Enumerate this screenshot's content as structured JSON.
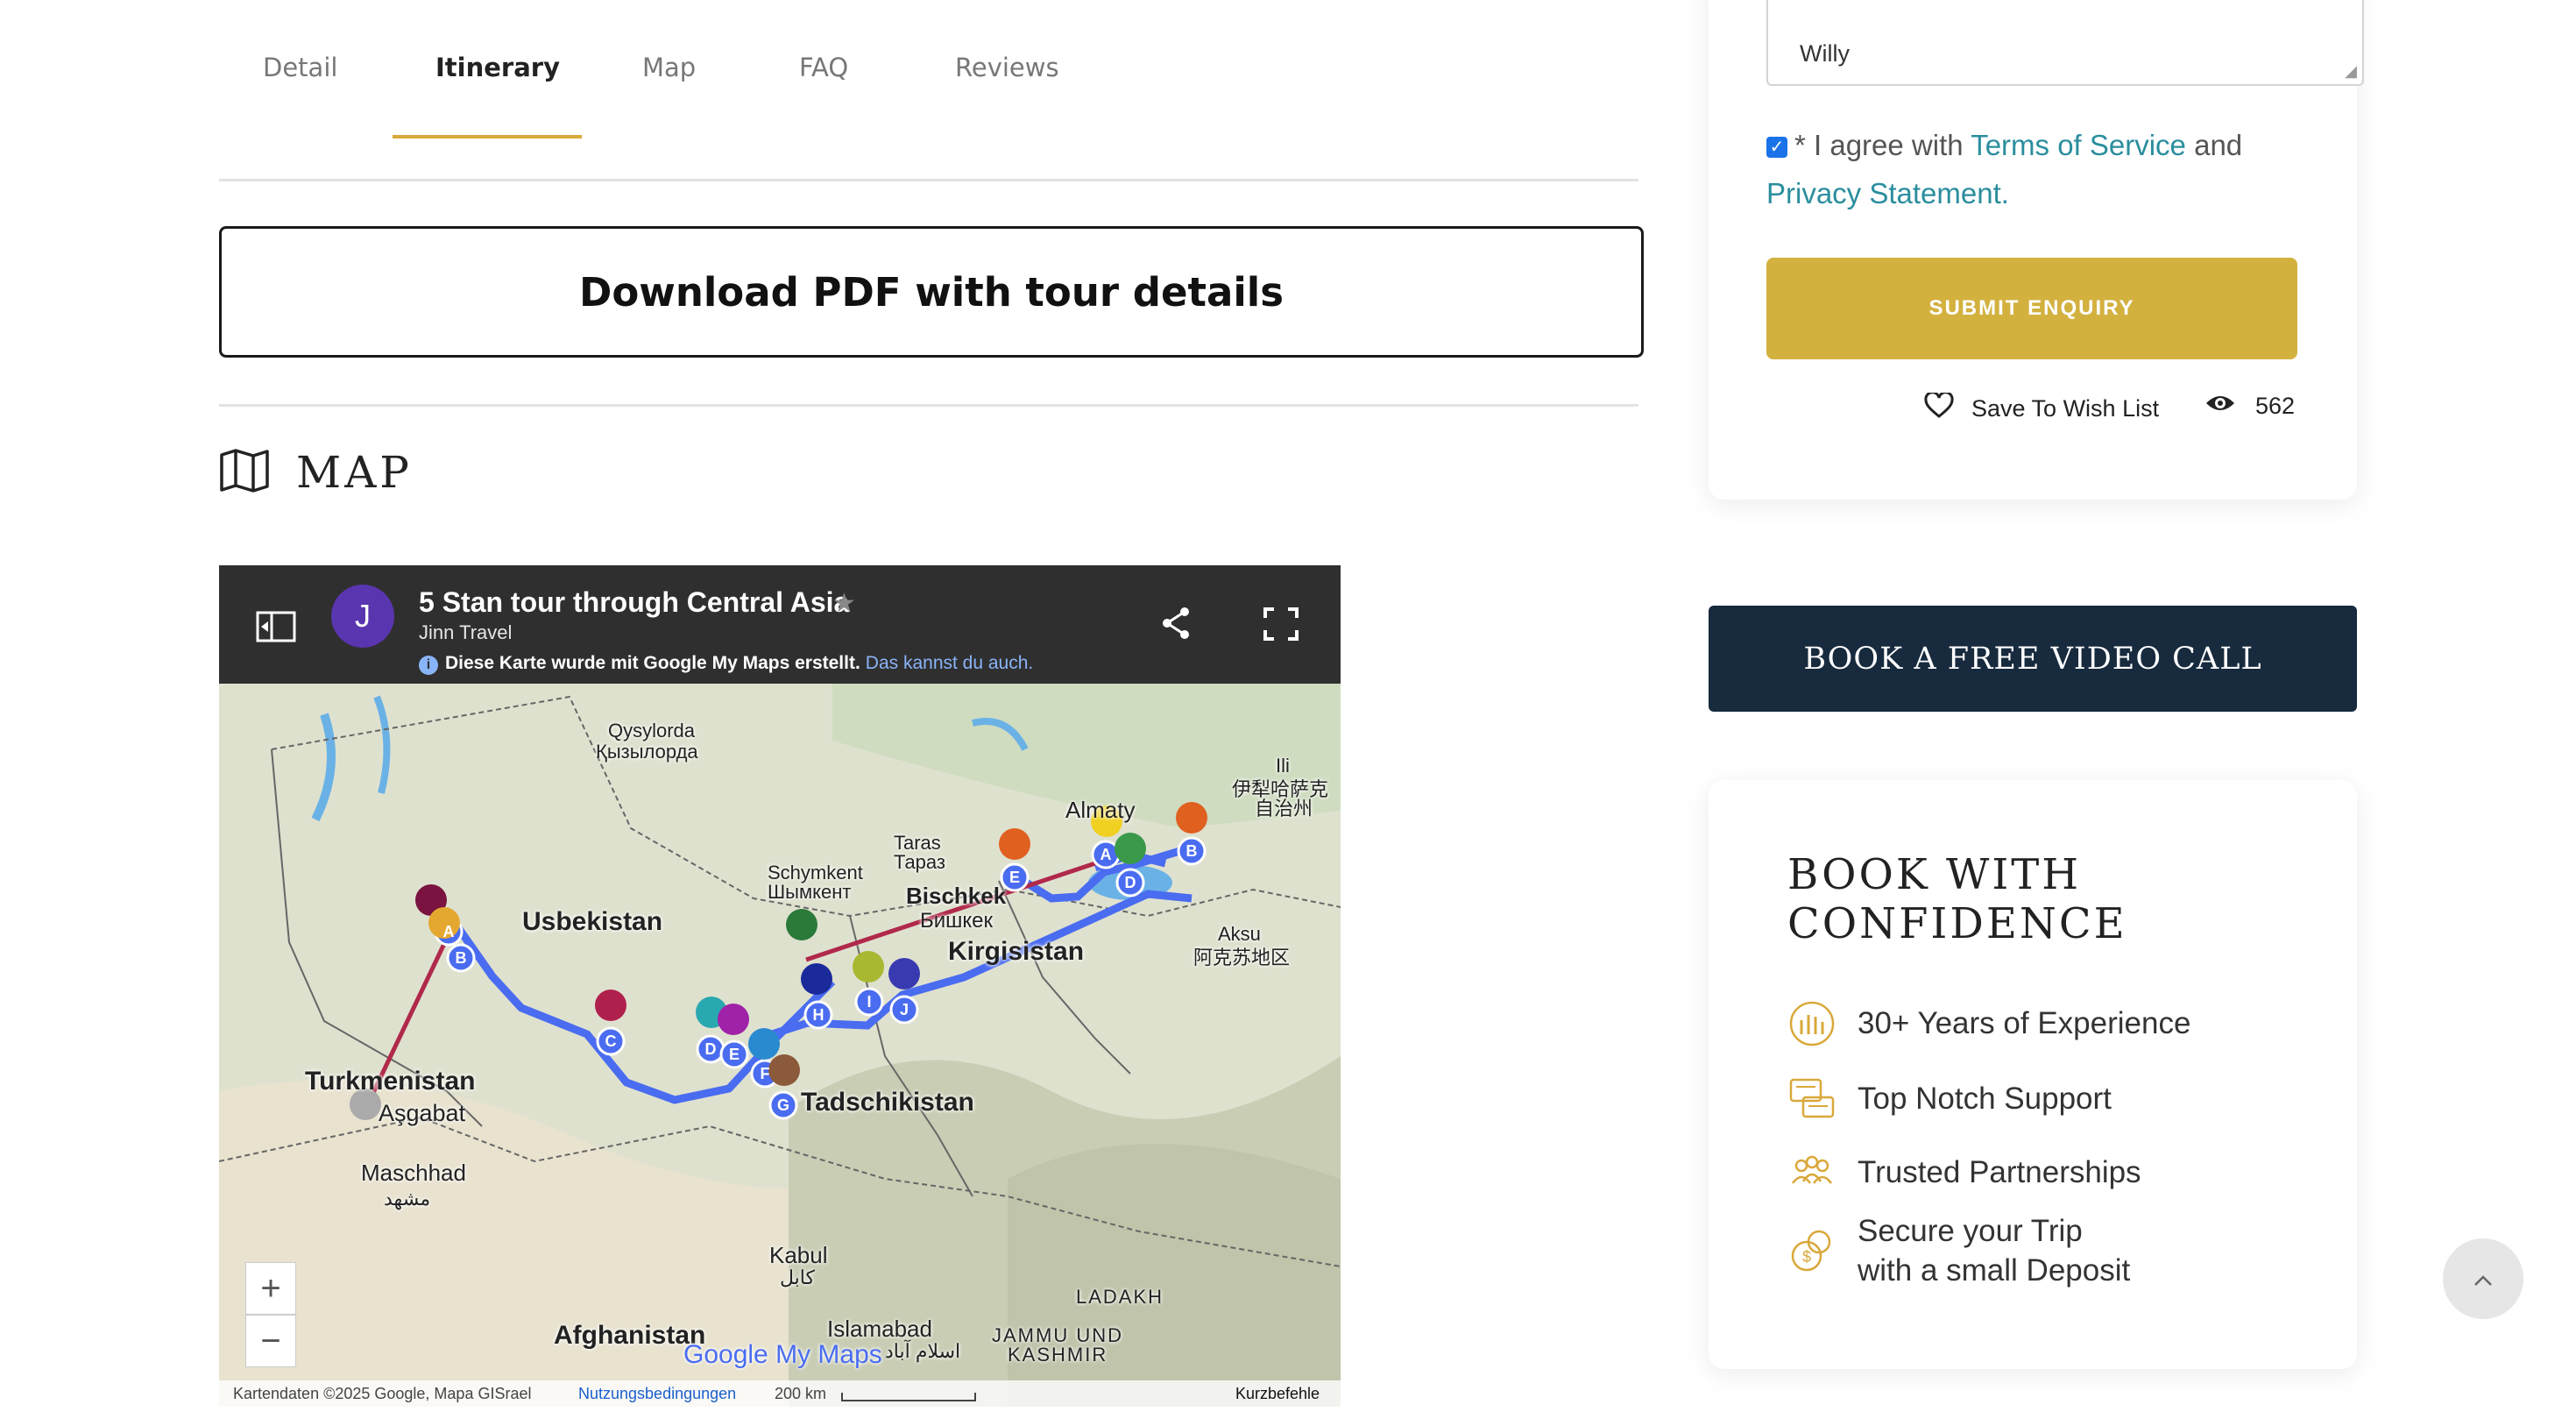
{
  "tabs": [
    {
      "label": "Detail"
    },
    {
      "label": "Itinerary"
    },
    {
      "label": "Map"
    },
    {
      "label": "FAQ"
    },
    {
      "label": "Reviews"
    }
  ],
  "active_tab": "Itinerary",
  "pdf_button_label": "Download PDF with tour details",
  "map_section_title": "MAP",
  "map": {
    "avatar_letter": "J",
    "title": "5 Stan tour through Central Asia",
    "author": "Jinn Travel",
    "note": "Diese Karte wurde mit Google My Maps erstellt.",
    "note_link": "Das kannst du auch.",
    "labels": {
      "qysylorda": "Qysylorda",
      "qysylorda_cyr": "Қызылорда",
      "usbekistan": "Usbekistan",
      "turkmenistan": "Turkmenistan",
      "asgabat": "Aşgabat",
      "maschhad": "Maschhad",
      "maschhad_fa": "مشهد",
      "schymkent": "Schymkent",
      "schymkent_cyr": "Шымкент",
      "taras": "Taras",
      "taras_cyr": "Тараз",
      "bischkek": "Bischkek",
      "bischkek_cyr": "Бишкек",
      "kirgisistan": "Kirgisistan",
      "almaty": "Almaty",
      "ili": "Ili",
      "ili_zh": "伊犁哈萨克",
      "ili_zh2": "自治州",
      "aksu": "Aksu",
      "aksu_zh": "阿克苏地区",
      "tadschikistan": "Tadschikistan",
      "kabul": "Kabul",
      "kabul_fa": "کابل",
      "afghanistan": "Afghanistan",
      "islamabad": "Islamabad",
      "islamabad_ur": "اسلام آباد",
      "ladakh": "LADAKH",
      "jammu": "JAMMU UND",
      "kashmir": "KASHMIR"
    },
    "watermark": "Google My Maps",
    "zoom_in": "+",
    "zoom_out": "−",
    "footer": {
      "attribution": "Kartendaten ©2025 Google, Mapa GISrael",
      "terms": "Nutzungsbedingungen",
      "scale": "200 km",
      "shortcuts": "Kurzbefehle"
    }
  },
  "form": {
    "textarea_text": "Willy",
    "agree_prefix": "* I agree with",
    "terms_link": "Terms of Service",
    "and": "and",
    "privacy_link": "Privacy Statement.",
    "submit_label": "SUBMIT ENQUIRY",
    "wishlist_label": "Save To Wish List",
    "views_count": "562"
  },
  "video_call_label": "BOOK A FREE VIDEO CALL",
  "confidence": {
    "title": "BOOK WITH CONFIDENCE",
    "features": [
      {
        "label": "30+ Years of Experience"
      },
      {
        "label": "Top Notch Support"
      },
      {
        "label": "Trusted Partnerships"
      },
      {
        "label": "Secure your Trip",
        "label2": "with a small Deposit"
      }
    ]
  },
  "colors": {
    "accent_gold": "#d3b13f",
    "navy": "#172a3e",
    "link_teal": "#2a8e9e",
    "route_blue": "#4a6cf0",
    "route_red": "#b0294b"
  }
}
